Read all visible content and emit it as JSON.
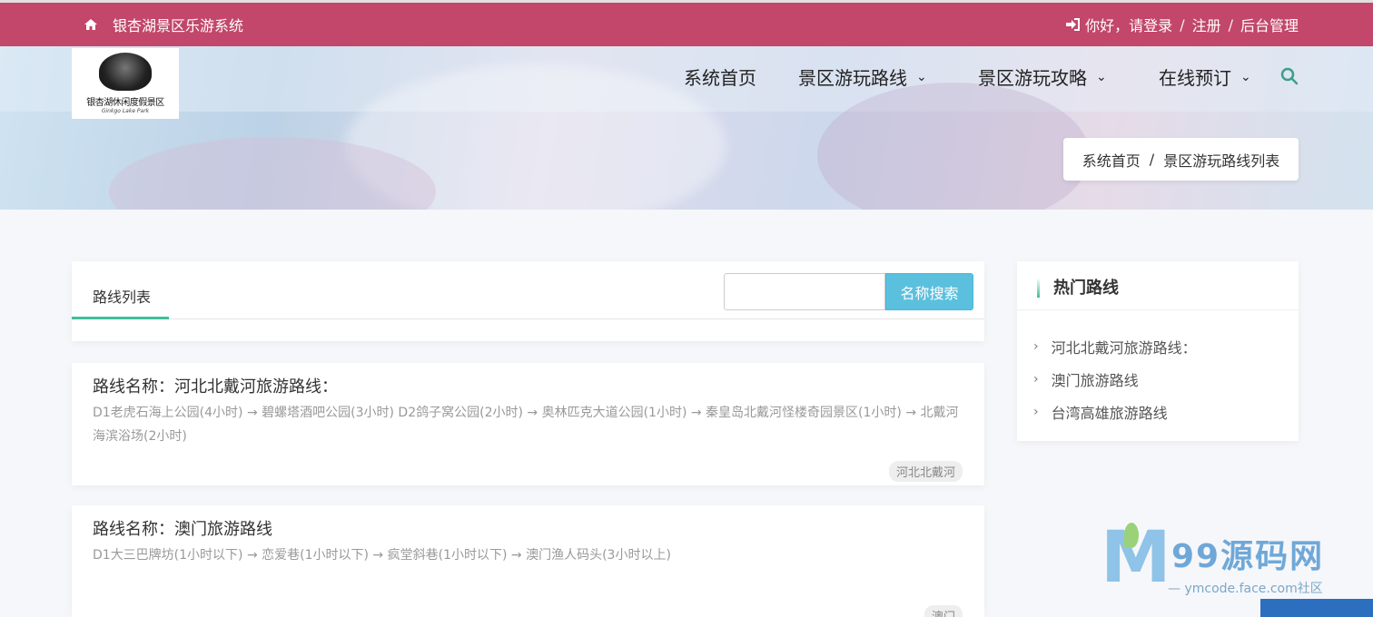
{
  "topbar": {
    "site_title": "银杏湖景区乐游系统",
    "greeting": "你好，请登录",
    "sep": "/",
    "register": "注册",
    "admin": "后台管理"
  },
  "logo": {
    "name": "银杏湖休闲度假景区",
    "sub": "Ginkgo Lake Park"
  },
  "nav": [
    {
      "label": "系统首页",
      "has_dropdown": false
    },
    {
      "label": "景区游玩路线",
      "has_dropdown": true
    },
    {
      "label": "景区游玩攻略",
      "has_dropdown": true
    },
    {
      "label": "在线预订",
      "has_dropdown": true
    }
  ],
  "breadcrumb": {
    "home": "系统首页",
    "sep": "/",
    "current": "景区游玩路线列表"
  },
  "list": {
    "title": "路线列表",
    "search_placeholder": "",
    "search_button": "名称搜索"
  },
  "routes": [
    {
      "name": "路线名称：河北北戴河旅游路线：",
      "desc": "D1老虎石海上公园(4小时) → 碧螺塔酒吧公园(3小时) D2鸽子窝公园(2小时) → 奥林匹克大道公园(1小时) → 秦皇岛北戴河怪楼奇园景区(1小时) → 北戴河海滨浴场(2小时)",
      "tag": "河北北戴河"
    },
    {
      "name": "路线名称：澳门旅游路线",
      "desc": "D1大三巴牌坊(1小时以下) → 恋爱巷(1小时以下) → 疯堂斜巷(1小时以下) → 澳门渔人码头(3小时以上)",
      "tag": "澳门"
    }
  ],
  "sidebar": {
    "title": "热门路线",
    "items": [
      "河北北戴河旅游路线：",
      "澳门旅游路线",
      "台湾高雄旅游路线"
    ]
  },
  "watermark": {
    "letter": "M",
    "brand": "99源码网",
    "url": "— ymcode.face.com社区"
  },
  "icons": {
    "home": "home-icon",
    "login": "sign-in-icon",
    "search": "search-icon",
    "chevron": "chevron-down-icon"
  },
  "colors": {
    "topbar": "#c2476a",
    "accent": "#3ebf9c",
    "search_btn": "#5bc0de"
  }
}
